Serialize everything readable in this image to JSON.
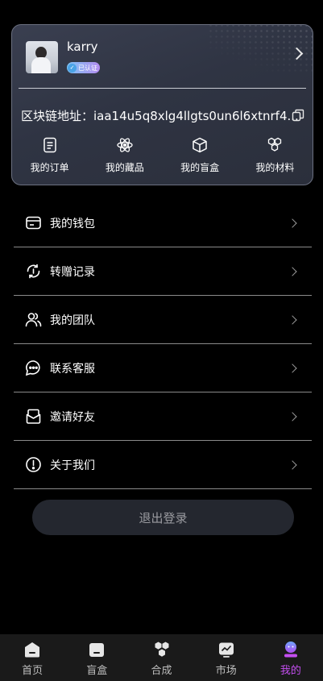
{
  "profile": {
    "username": "karry",
    "verified_badge": "已认证",
    "blockchain_address": "区块链地址：iaa14u5q8xlg4llgts0un6l6xtnrf4..."
  },
  "quick_links": [
    {
      "label": "我的订单",
      "icon": "order-icon"
    },
    {
      "label": "我的藏品",
      "icon": "collection-atom-icon"
    },
    {
      "label": "我的盲盒",
      "icon": "blindbox-cube-icon"
    },
    {
      "label": "我的材料",
      "icon": "materials-hexagon-icon"
    }
  ],
  "menu": [
    {
      "label": "我的钱包",
      "icon": "wallet-icon"
    },
    {
      "label": "转赠记录",
      "icon": "transfer-icon"
    },
    {
      "label": "我的团队",
      "icon": "team-icon"
    },
    {
      "label": "联系客服",
      "icon": "chat-icon"
    },
    {
      "label": "邀请好友",
      "icon": "invite-icon"
    },
    {
      "label": "关于我们",
      "icon": "info-icon"
    }
  ],
  "logout_label": "退出登录",
  "tabbar": {
    "active_color": "#c44ef0",
    "tabs": [
      {
        "label": "首页",
        "icon": "home-icon"
      },
      {
        "label": "盲盒",
        "icon": "blindbox-icon"
      },
      {
        "label": "合成",
        "icon": "synthesis-icon"
      },
      {
        "label": "市场",
        "icon": "market-icon"
      },
      {
        "label": "我的",
        "icon": "profile-icon",
        "active": true
      }
    ]
  }
}
